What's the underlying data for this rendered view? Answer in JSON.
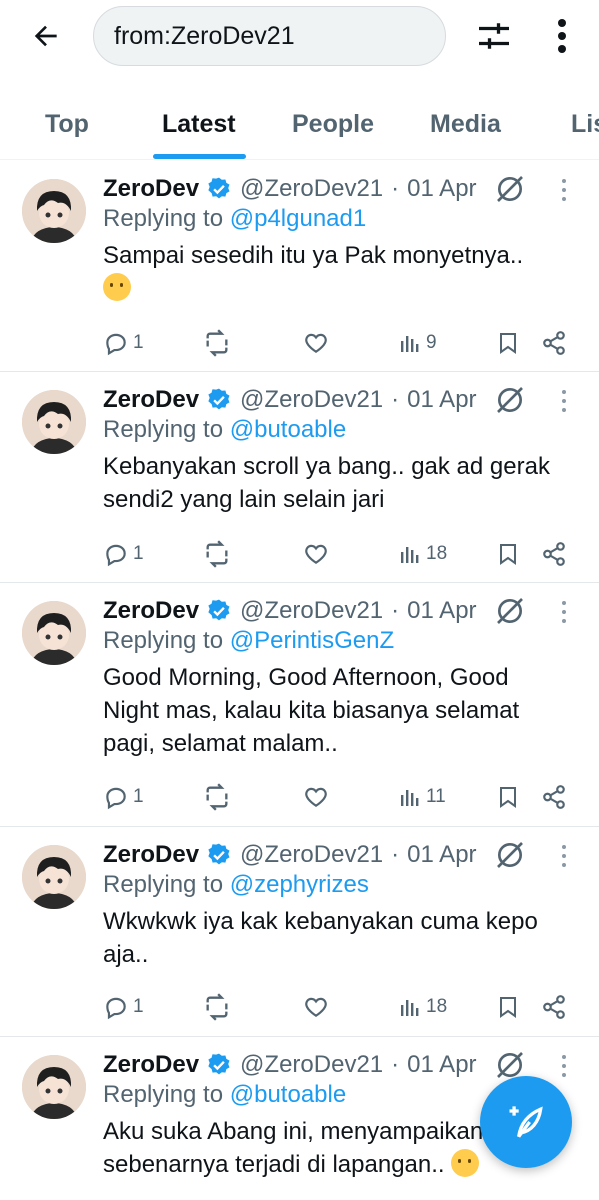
{
  "header": {
    "search_query": "from:ZeroDev21"
  },
  "tabs": [
    {
      "label": "Top",
      "active": false
    },
    {
      "label": "Latest",
      "active": true
    },
    {
      "label": "People",
      "active": false
    },
    {
      "label": "Media",
      "active": false
    },
    {
      "label": "Lis",
      "active": false
    }
  ],
  "tweets": [
    {
      "name": "ZeroDev",
      "handle": "@ZeroDev21",
      "date": "01 Apr",
      "replying_label": "Replying to",
      "replying_to": "@p4lgunad1",
      "text": "Sampai sesedih itu ya Pak monyetnya..",
      "emoji": "tear-smile",
      "replies": "1",
      "retweets": "",
      "likes": "",
      "views": "9"
    },
    {
      "name": "ZeroDev",
      "handle": "@ZeroDev21",
      "date": "01 Apr",
      "replying_label": "Replying to",
      "replying_to": "@butoable",
      "text": "Kebanyakan scroll ya bang.. gak ad gerak sendi2 yang lain selain jari",
      "replies": "1",
      "retweets": "",
      "likes": "",
      "views": "18"
    },
    {
      "name": "ZeroDev",
      "handle": "@ZeroDev21",
      "date": "01 Apr",
      "replying_label": "Replying to",
      "replying_to": "@PerintisGenZ",
      "text": "Good Morning, Good Afternoon, Good Night mas, kalau kita biasanya selamat pagi, selamat malam..",
      "replies": "1",
      "retweets": "",
      "likes": "",
      "views": "11"
    },
    {
      "name": "ZeroDev",
      "handle": "@ZeroDev21",
      "date": "01 Apr",
      "replying_label": "Replying to",
      "replying_to": "@zephyrizes",
      "text": "Wkwkwk iya kak kebanyakan cuma kepo aja..",
      "replies": "1",
      "retweets": "",
      "likes": "",
      "views": "18"
    },
    {
      "name": "ZeroDev",
      "handle": "@ZeroDev21",
      "date": "01 Apr",
      "replying_label": "Replying to",
      "replying_to": "@butoable",
      "text": "Aku suka Abang ini, menyampaikan yang sebenarnya terjadi di lapangan..",
      "emoji": "crying-face",
      "replies": "",
      "retweets": "",
      "likes": "",
      "views": ""
    }
  ],
  "colors": {
    "accent": "#1d9bf0",
    "text_primary": "#0f1419",
    "text_secondary": "#536471"
  },
  "icons": {
    "back": "arrow-left-icon",
    "filter": "sliders-icon",
    "more": "vertical-ellipsis-icon",
    "verified": "verified-badge-icon",
    "grok": "grok-icon",
    "reply": "reply-icon",
    "retweet": "retweet-icon",
    "like": "heart-icon",
    "views": "views-icon",
    "bookmark": "bookmark-icon",
    "share": "share-icon",
    "compose": "compose-post-icon"
  }
}
